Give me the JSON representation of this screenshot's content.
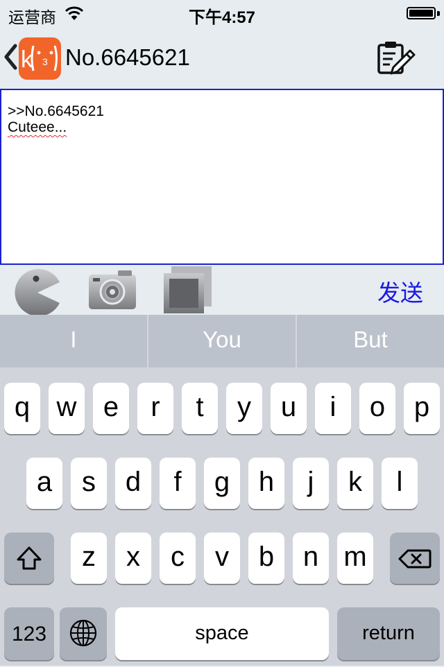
{
  "status_bar": {
    "carrier": "运营商",
    "time": "下午4:57",
    "icons": [
      "wifi-icon",
      "battery-icon"
    ]
  },
  "nav": {
    "back_icon": "chevron-left-icon",
    "logo_text": "k",
    "logo_face": "·3·)",
    "title": "No.6645621",
    "compose_icon": "clipboard-pencil-icon"
  },
  "reply": {
    "line1": ">>No.6645621",
    "line2": "Cuteee..."
  },
  "toolbar": {
    "emoticon_icon": "pacman-icon",
    "camera_icon": "camera-icon",
    "gallery_icon": "photo-gallery-icon",
    "send_label": "发送"
  },
  "keyboard": {
    "suggestions": [
      "I",
      "You",
      "But"
    ],
    "row1": [
      "q",
      "w",
      "e",
      "r",
      "t",
      "y",
      "u",
      "i",
      "o",
      "p"
    ],
    "row2": [
      "a",
      "s",
      "d",
      "f",
      "g",
      "h",
      "j",
      "k",
      "l"
    ],
    "row3": [
      "z",
      "x",
      "c",
      "v",
      "b",
      "n",
      "m"
    ],
    "shift_icon": "shift-icon",
    "delete_icon": "delete-icon",
    "numbers_label": "123",
    "globe_icon": "globe-icon",
    "space_label": "space",
    "return_label": "return"
  },
  "colors": {
    "logo": "#f2652a",
    "textbox_border": "#1a23c9",
    "send": "#1818e8",
    "spell_underline": "#e0282e"
  }
}
